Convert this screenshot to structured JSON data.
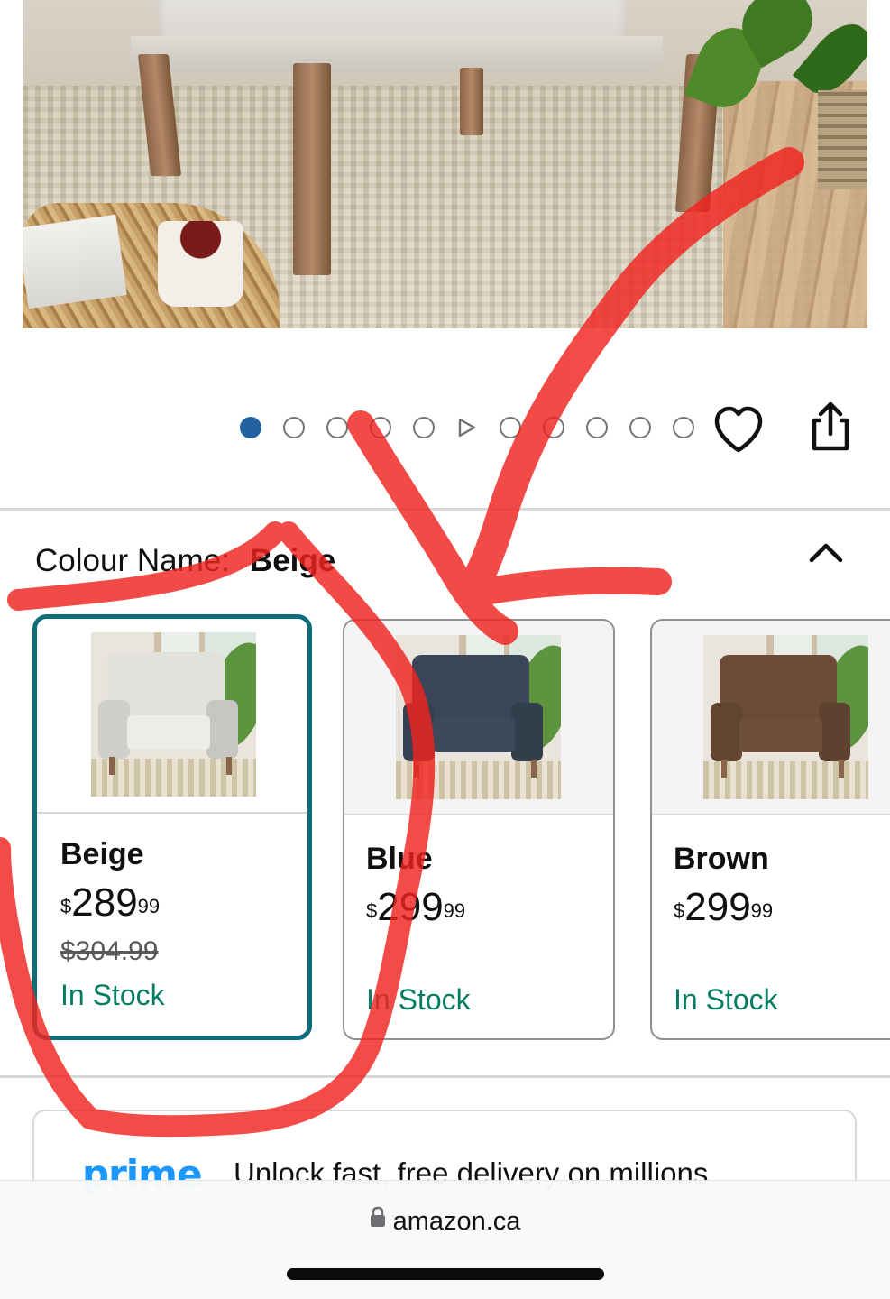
{
  "carousel": {
    "slide_count": 10,
    "active_index": 0,
    "video_index": 5,
    "accent_color": "#2162a1"
  },
  "actions": {
    "wishlist_icon": "heart-icon",
    "share_icon": "share-icon"
  },
  "variation": {
    "label": "Colour Name:",
    "selected_value": "Beige",
    "collapse_icon": "chevron-up-icon",
    "options": [
      {
        "name": "Beige",
        "currency": "$",
        "price_whole": "289",
        "price_fraction": "99",
        "list_price": "$304.99",
        "stock": "In Stock",
        "selected": true,
        "fabric_color": "#e3e1dc"
      },
      {
        "name": "Blue",
        "currency": "$",
        "price_whole": "299",
        "price_fraction": "99",
        "list_price": "",
        "stock": "In Stock",
        "selected": false,
        "fabric_color": "#3a4658"
      },
      {
        "name": "Brown",
        "currency": "$",
        "price_whole": "299",
        "price_fraction": "99",
        "list_price": "",
        "stock": "In Stock",
        "selected": false,
        "fabric_color": "#6b4b35"
      }
    ],
    "selected_border_color": "#0e6d7a",
    "stock_color": "#067d62"
  },
  "prime": {
    "logo_text": "prime",
    "message": "Unlock fast, free delivery on millions",
    "brand_color": "#1a98ff"
  },
  "browser": {
    "url": "amazon.ca",
    "lock_icon": "lock-icon"
  },
  "annotation": {
    "ink_color": "#f0231e"
  }
}
